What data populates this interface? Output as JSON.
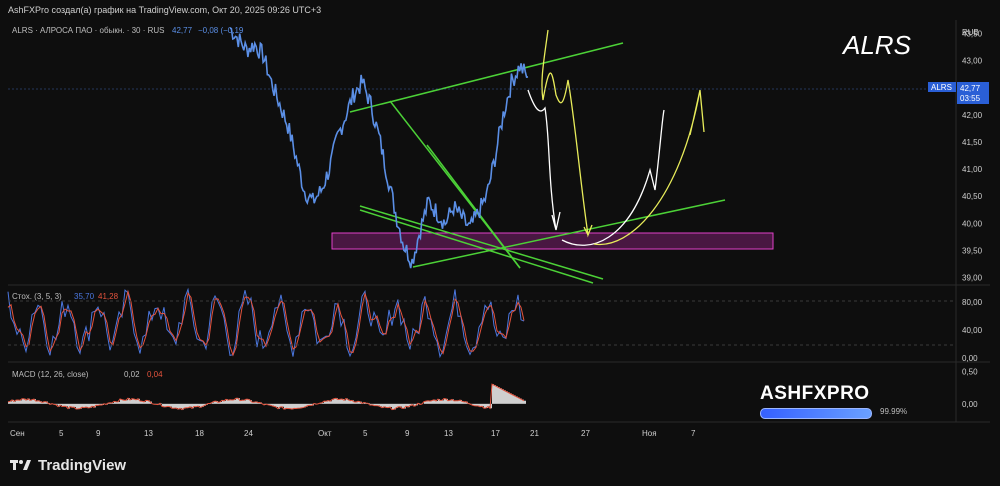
{
  "window": {
    "title": "AshFXPro создал(а) график на TradingView.com, Окт 20, 2025 09:26 UTC+3"
  },
  "legend": {
    "symbol_line": "ALRS · АЛРОСА ПАО · обыкн. · 30 · RUS",
    "last": "42,77",
    "change": "−0,08 (−0,19",
    "stoch_label": "Стох. (3, 5, 3)",
    "stoch_k": "35,70",
    "stoch_d": "41,28",
    "macd_label": "MACD (12, 26, close)",
    "macd_val": "0,02",
    "macd_sig": "0,04"
  },
  "watermark": "ALRS",
  "currency": "RUB",
  "price_tag": {
    "symbol": "ALRS",
    "price": "42,77",
    "countdown": "03:55"
  },
  "brand": {
    "name": "ASHFXPRO",
    "percent": "99.99%"
  },
  "footer": {
    "logo": "TradingView"
  },
  "colors": {
    "price_line": "#5b8fe6",
    "trendline": "#4cd137",
    "zone_fill": "#7a1f6e",
    "zone_border": "#e040c8",
    "projection_white": "#ffffff",
    "projection_yellow": "#e8ec5a",
    "stoch_k": "#4b77e0",
    "stoch_d": "#e5533d",
    "macd_hist": "#cfcfcf",
    "macd_line": "#e5533d"
  },
  "chart_data": [
    {
      "type": "line",
      "title": "ALRS · АЛРОСА ПАО · обыкн. · 30 · RUS",
      "y_axis": {
        "ticks": [
          "43,50",
          "43,00",
          "42,00",
          "41,50",
          "41,00",
          "40,50",
          "40,00",
          "39,50",
          "39,00"
        ],
        "ylim": [
          38.9,
          43.75
        ]
      },
      "x_axis": {
        "ticks": [
          "Сен",
          "5",
          "9",
          "13",
          "18",
          "24",
          "Окт",
          "5",
          "9",
          "13",
          "17",
          "21",
          "27",
          "Ноя",
          "7"
        ]
      },
      "series": [
        {
          "values": [
            43.6,
            43.4,
            43.2,
            43.3,
            43.1,
            42.6,
            42.2,
            41.8,
            41.2,
            40.6,
            40.4,
            40.6,
            41.0,
            41.6,
            42.0,
            42.4,
            42.6,
            42.2,
            41.6,
            40.9,
            40.2,
            39.6,
            39.3,
            39.9,
            40.4,
            40.2,
            40.0,
            40.3,
            40.1,
            39.9,
            40.2,
            40.5,
            41.2,
            42.0,
            42.6,
            42.9,
            42.7
          ]
        }
      ],
      "annotations": {
        "trend_channel": "ascending lines",
        "support_zone": [
          39.6,
          39.85
        ]
      }
    },
    {
      "type": "line",
      "title": "Стох. (3, 5, 3)",
      "y_axis": {
        "ticks": [
          "80,00",
          "40,00",
          "0,00"
        ],
        "ylim": [
          0,
          100
        ]
      },
      "series": [
        {
          "name": "K",
          "value": 35.7
        },
        {
          "name": "D",
          "value": 41.28
        }
      ]
    },
    {
      "type": "bar",
      "title": "MACD (12, 26, close)",
      "y_axis": {
        "ticks": [
          "0,50",
          "0,00"
        ],
        "ylim": [
          -0.25,
          0.6
        ]
      },
      "series": [
        {
          "name": "MACD",
          "value": 0.02
        },
        {
          "name": "Signal",
          "value": 0.04
        }
      ]
    }
  ]
}
